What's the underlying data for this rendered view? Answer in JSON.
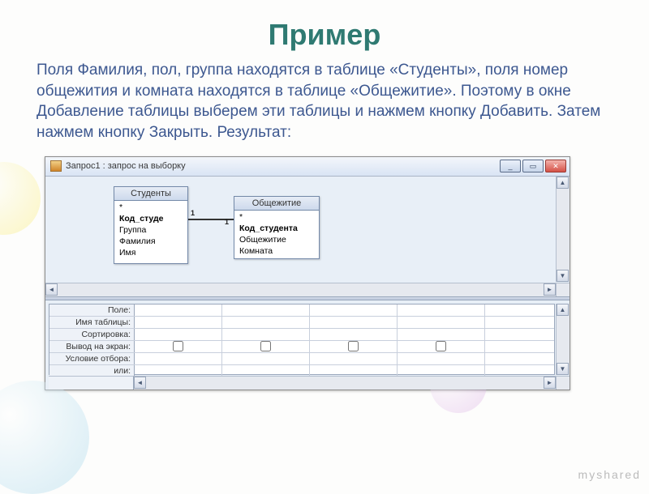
{
  "page": {
    "heading": "Пример",
    "description": "Поля Фамилия, пол, группа находятся в таблице «Студенты», поля номер общежития и комната находятся в таблице «Общежитие». Поэтому в окне Добавление таблицы выберем эти таблицы и нажмем кнопку Добавить. Затем нажмем кнопку Закрыть. Результат:",
    "watermark": "myshared"
  },
  "window": {
    "title": "Запрос1 : запрос на выборку",
    "controls": {
      "min": "_",
      "max": "▭",
      "close": "✕"
    }
  },
  "tables": {
    "students": {
      "name": "Студенты",
      "fields": [
        "*",
        "Код_студе",
        "Группа",
        "Фамилия",
        "Имя"
      ]
    },
    "dorm": {
      "name": "Общежитие",
      "fields": [
        "*",
        "Код_студента",
        "Общежитие",
        "Комната"
      ]
    },
    "relation": {
      "left": "1",
      "right": "1"
    }
  },
  "designGrid": {
    "rows": [
      "Поле:",
      "Имя таблицы:",
      "Сортировка:",
      "Вывод на экран:",
      "Условие отбора:",
      "или:"
    ],
    "showRowIndex": 3,
    "columns": 4
  }
}
